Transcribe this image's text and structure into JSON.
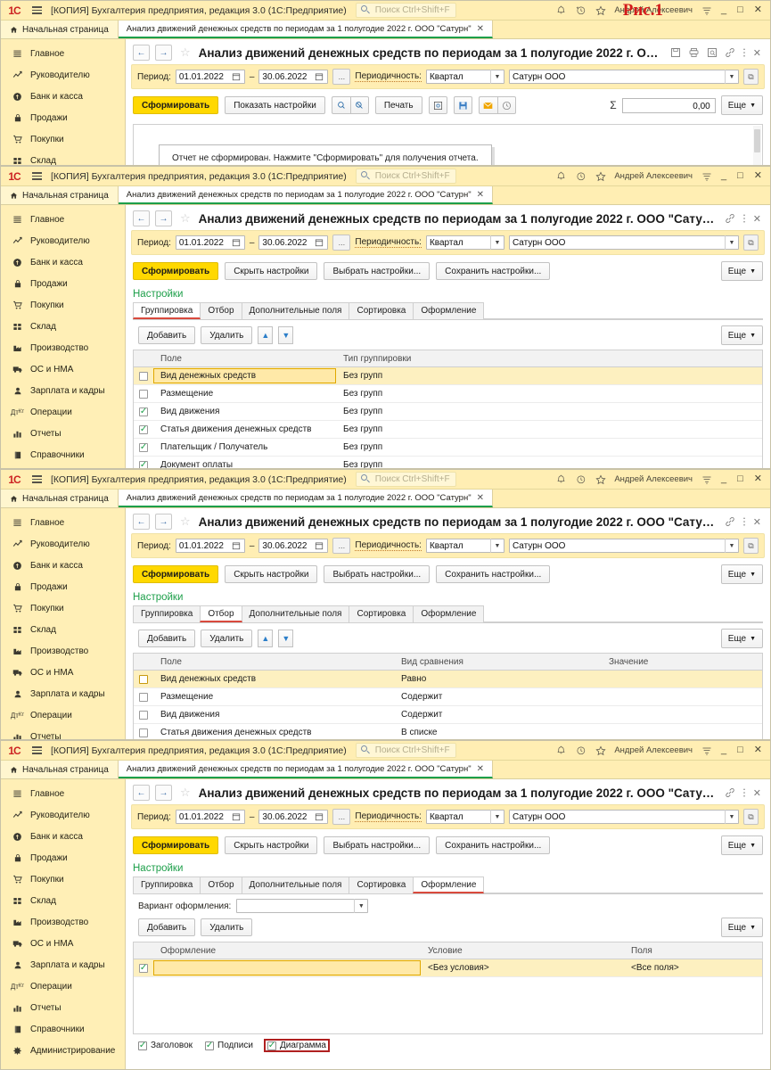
{
  "app": {
    "logo": "1C",
    "title": "[КОПИЯ] Бухгалтерия предприятия, редакция 3.0  (1С:Предприятие)",
    "search_placeholder": "Поиск Ctrl+Shift+F",
    "user": "Андрей Алексеевич",
    "minimize": "_",
    "maximize": "□",
    "close": "✕"
  },
  "tabs": {
    "home": "Начальная страница",
    "document": "Анализ движений денежных средств по периодам за 1 полугодие 2022 г. ООО \"Сатурн\"",
    "close_mark": "✕"
  },
  "figure_label": "Рис.1",
  "sidebar": {
    "items": [
      {
        "label": "Главное",
        "icon": "menu-icon"
      },
      {
        "label": "Руководителю",
        "icon": "trend-up-icon"
      },
      {
        "label": "Банк и касса",
        "icon": "coin-icon"
      },
      {
        "label": "Продажи",
        "icon": "bag-icon"
      },
      {
        "label": "Покупки",
        "icon": "cart-icon"
      },
      {
        "label": "Склад",
        "icon": "grid-icon"
      },
      {
        "label": "Производство",
        "icon": "factory-icon"
      },
      {
        "label": "ОС и НМА",
        "icon": "truck-icon"
      },
      {
        "label": "Зарплата и кадры",
        "icon": "person-icon"
      },
      {
        "label": "Операции",
        "icon": "debit-credit-icon"
      },
      {
        "label": "Отчеты",
        "icon": "bar-chart-icon"
      },
      {
        "label": "Справочники",
        "icon": "book-icon"
      },
      {
        "label": "Администрирование",
        "icon": "gear-icon"
      }
    ]
  },
  "doc": {
    "title_truncated": "Анализ движений денежных средств по периодам за 1 полугодие 2022 г. ООО \"...",
    "title_full": "Анализ движений денежных средств по периодам за 1 полугодие 2022 г. ООО \"Сатурн\"",
    "back": "←",
    "forward": "→",
    "star": "☆"
  },
  "params": {
    "period_label": "Период:",
    "date_from": "01.01.2022",
    "date_to": "30.06.2022",
    "dash": "–",
    "ellipsis": "...",
    "periodicity_label": "Периодичность:",
    "periodicity_value": "Квартал",
    "org_value": "Сатурн ООО"
  },
  "commands": {
    "generate": "Сформировать",
    "show_settings": "Показать настройки",
    "hide_settings": "Скрыть настройки",
    "choose_settings": "Выбрать настройки...",
    "save_settings": "Сохранить настройки...",
    "print": "Печать",
    "sum_value": "0,00",
    "more": "Еще"
  },
  "report": {
    "empty_message": "Отчет не сформирован. Нажмите \"Сформировать\" для получения отчета."
  },
  "settings": {
    "header": "Настройки",
    "tabs": [
      "Группировка",
      "Отбор",
      "Дополнительные поля",
      "Сортировка",
      "Оформление"
    ],
    "toolbar": {
      "add": "Добавить",
      "remove": "Удалить",
      "up": "▲",
      "down": "▼",
      "more": "Еще"
    },
    "variant_label": "Вариант оформления:"
  },
  "grouping_tab": {
    "columns": [
      "Поле",
      "Тип группировки"
    ],
    "rows": [
      {
        "checked": false,
        "field": "Вид денежных средств",
        "type": "Без групп",
        "selected": true
      },
      {
        "checked": false,
        "field": "Размещение",
        "type": "Без групп",
        "selected": false
      },
      {
        "checked": true,
        "field": "Вид движения",
        "type": "Без групп",
        "selected": false
      },
      {
        "checked": true,
        "field": "Статья движения денежных средств",
        "type": "Без групп",
        "selected": false
      },
      {
        "checked": true,
        "field": "Плательщик / Получатель",
        "type": "Без групп",
        "selected": false
      },
      {
        "checked": true,
        "field": "Документ оплаты",
        "type": "Без групп",
        "selected": false
      }
    ]
  },
  "filter_tab": {
    "columns": [
      "Поле",
      "Вид сравнения",
      "Значение"
    ],
    "rows": [
      {
        "checked": false,
        "field": "Вид денежных средств",
        "comparison": "Равно",
        "value": "",
        "selected": true
      },
      {
        "checked": false,
        "field": "Размещение",
        "comparison": "Содержит",
        "value": "",
        "selected": false
      },
      {
        "checked": false,
        "field": "Вид движения",
        "comparison": "Содержит",
        "value": "",
        "selected": false
      },
      {
        "checked": false,
        "field": "Статья движения денежных средств",
        "comparison": "В списке",
        "value": "",
        "selected": false
      }
    ]
  },
  "appearance_tab": {
    "columns": [
      "Оформление",
      "Условие",
      "Поля"
    ],
    "rows": [
      {
        "checked": true,
        "appearance": "",
        "condition": "<Без условия>",
        "fields": "<Все поля>",
        "selected": true
      }
    ],
    "footer_checks": [
      {
        "label": "Заголовок",
        "checked": true,
        "highlighted": false
      },
      {
        "label": "Подписи",
        "checked": true,
        "highlighted": false
      },
      {
        "label": "Диаграмма",
        "checked": true,
        "highlighted": true
      }
    ]
  },
  "colors": {
    "accent_yellow": "#ffd800",
    "panel_yellow": "#ffeeb3",
    "sidebar_yellow": "#ffefb6",
    "settings_green": "#1d9f4a",
    "tab_underline_red": "#d94a3d",
    "highlight_red": "#b02020",
    "figure_red": "#d21a1a"
  }
}
